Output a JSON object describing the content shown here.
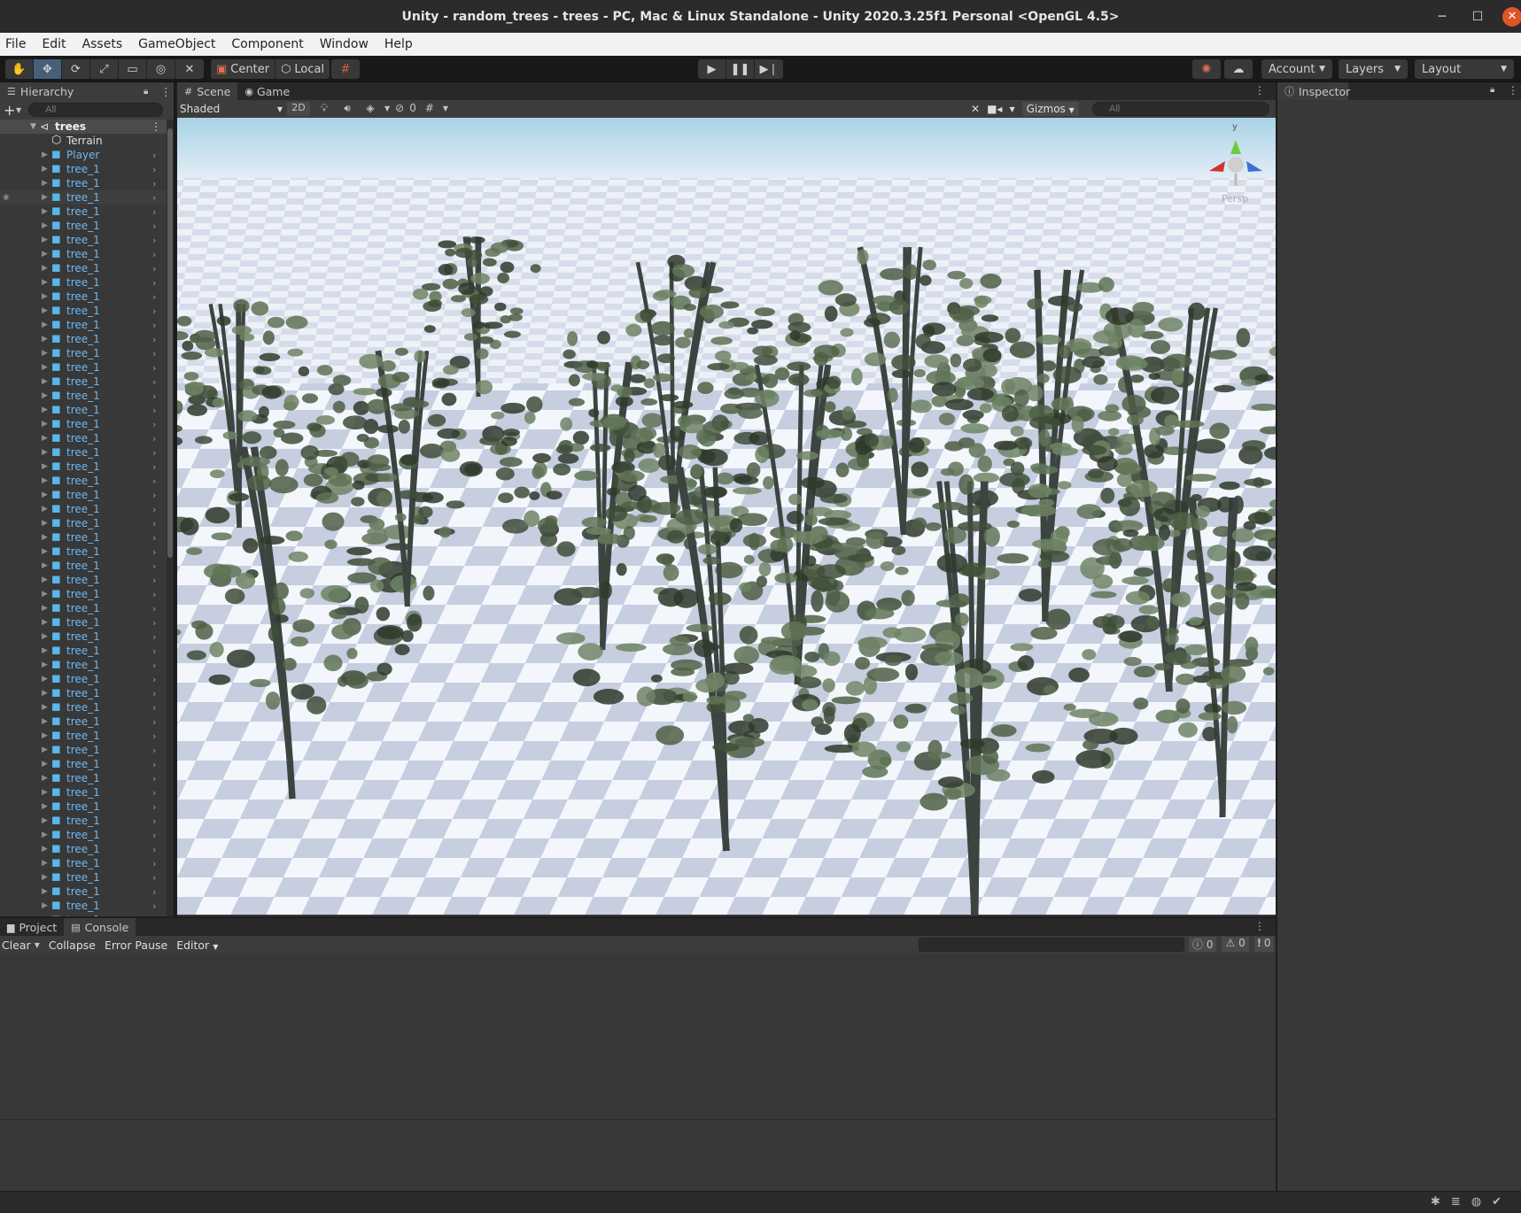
{
  "window": {
    "title": "Unity - random_trees - trees - PC, Mac & Linux Standalone - Unity 2020.3.25f1 Personal <OpenGL 4.5>"
  },
  "menu": [
    "File",
    "Edit",
    "Assets",
    "GameObject",
    "Component",
    "Window",
    "Help"
  ],
  "toolbar": {
    "pivot_label": "Center",
    "space_label": "Local",
    "account_label": "Account",
    "layers_label": "Layers",
    "layout_label": "Layout"
  },
  "hierarchy": {
    "tab_label": "Hierarchy",
    "search_placeholder": "All",
    "root": "trees",
    "items": [
      "Terrain",
      "Player",
      "tree_1",
      "tree_1",
      "tree_1",
      "tree_1",
      "tree_1",
      "tree_1",
      "tree_1",
      "tree_1",
      "tree_1",
      "tree_1",
      "tree_1",
      "tree_1",
      "tree_1",
      "tree_1",
      "tree_1",
      "tree_1",
      "tree_1",
      "tree_1",
      "tree_1",
      "tree_1",
      "tree_1",
      "tree_1",
      "tree_1",
      "tree_1",
      "tree_1",
      "tree_1",
      "tree_1",
      "tree_1",
      "tree_1",
      "tree_1",
      "tree_1",
      "tree_1",
      "tree_1",
      "tree_1",
      "tree_1",
      "tree_1",
      "tree_1",
      "tree_1",
      "tree_1",
      "tree_1",
      "tree_1",
      "tree_1",
      "tree_1",
      "tree_1",
      "tree_1",
      "tree_1",
      "tree_1",
      "tree_1",
      "tree_1",
      "tree_1",
      "tree_1",
      "tree_1",
      "tree_1",
      "tree_1"
    ]
  },
  "scene": {
    "tabs": [
      "Scene",
      "Game"
    ],
    "shading_mode": "Shaded",
    "mode_2d_label": "2D",
    "hidden_count": "0",
    "gizmos_label": "Gizmos",
    "search_placeholder": "All",
    "gizmo_axis_label": "y",
    "projection_label": "Persp"
  },
  "inspector": {
    "tab_label": "Inspector"
  },
  "bottom": {
    "tabs": [
      "Project",
      "Console"
    ],
    "clear_label": "Clear",
    "collapse_label": "Collapse",
    "error_pause_label": "Error Pause",
    "editor_label": "Editor",
    "log_count": "0",
    "warn_count": "0",
    "error_count": "0"
  },
  "colors": {
    "selection": "#46607c",
    "prefab_text": "#6eb7f2",
    "panel": "#383838"
  }
}
